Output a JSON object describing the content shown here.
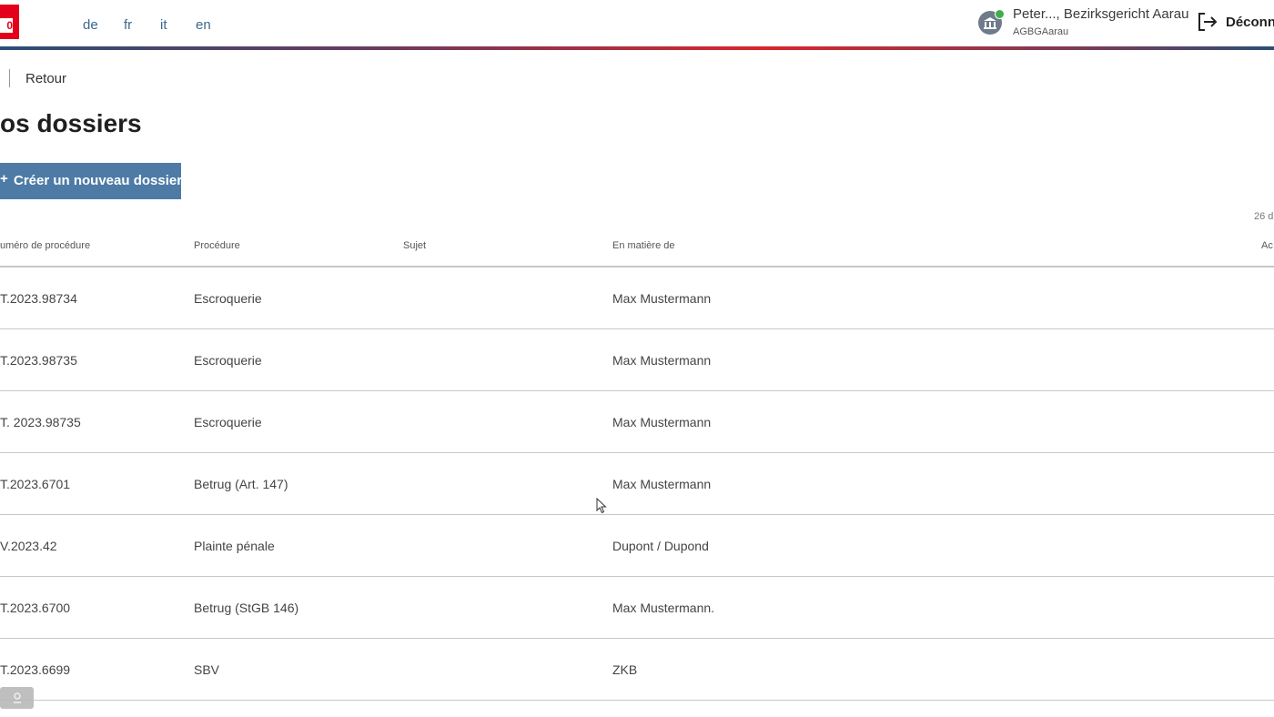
{
  "header": {
    "logo_text": "0",
    "languages": [
      "de",
      "fr",
      "it",
      "en"
    ],
    "user": {
      "name": "Peter..., Bezirksgericht Aarau",
      "org": "AGBGAarau"
    },
    "logout_label": "Déconn"
  },
  "nav": {
    "back_label": "Retour"
  },
  "page": {
    "title": "os dossiers",
    "create_button": {
      "plus": "+",
      "label": "Créer un nouveau dossier"
    },
    "count_label": "26 d"
  },
  "table": {
    "columns": [
      "uméro de procédure",
      "Procédure",
      "Sujet",
      "En matière de",
      "Ac"
    ],
    "rows": [
      {
        "number": "T.2023.98734",
        "procedure": "Escroquerie",
        "subject": "",
        "matter": "Max Mustermann"
      },
      {
        "number": "T.2023.98735",
        "procedure": "Escroquerie",
        "subject": "",
        "matter": "Max Mustermann"
      },
      {
        "number": "T. 2023.98735",
        "procedure": "Escroquerie",
        "subject": "",
        "matter": "Max Mustermann"
      },
      {
        "number": "T.2023.6701",
        "procedure": "Betrug (Art. 147)",
        "subject": "",
        "matter": "Max Mustermann"
      },
      {
        "number": "V.2023.42",
        "procedure": "Plainte pénale",
        "subject": "",
        "matter": "Dupont / Dupond"
      },
      {
        "number": "T.2023.6700",
        "procedure": "Betrug (StGB 146)",
        "subject": "",
        "matter": "Max Mustermann."
      },
      {
        "number": "T.2023.6699",
        "procedure": "SBV",
        "subject": "",
        "matter": "ZKB"
      }
    ]
  },
  "colors": {
    "accent": "#4d7ba6",
    "brand_red": "#e4001b",
    "link": "#3b6890"
  },
  "icons": {
    "user": "courthouse-icon",
    "logout": "logout-icon",
    "feedback": "feedback-icon"
  }
}
